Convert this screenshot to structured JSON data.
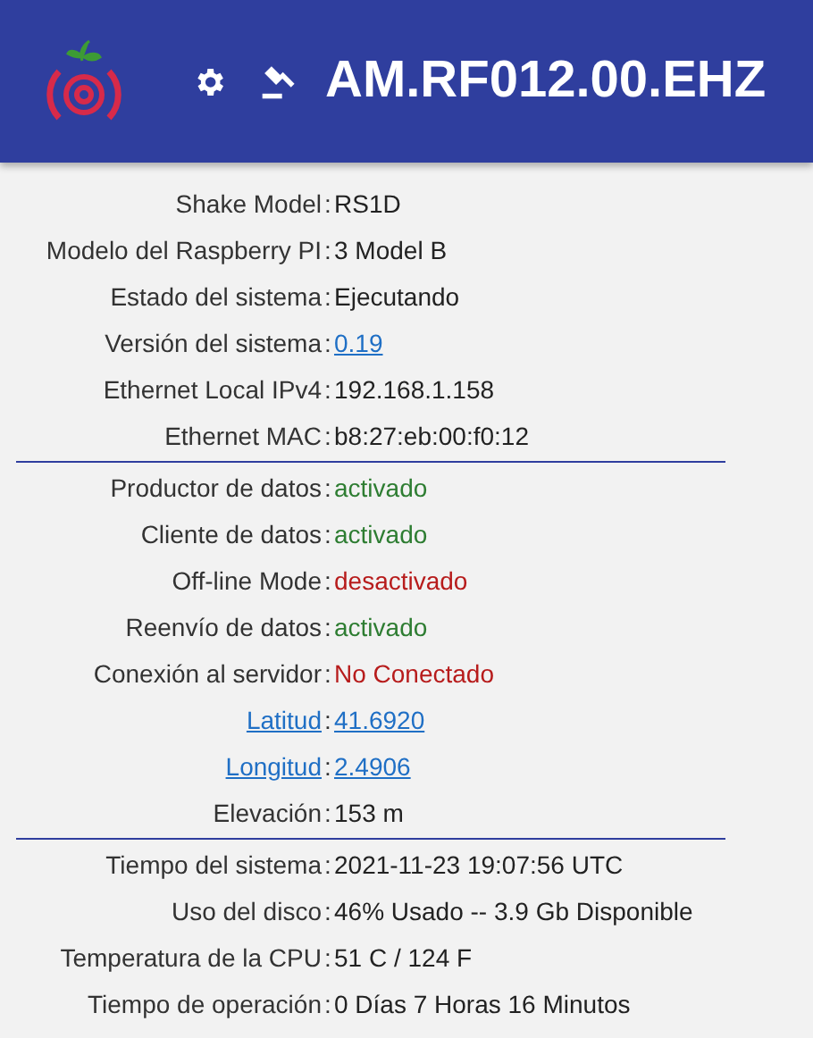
{
  "header": {
    "title": "AM.RF012.00.EHZ"
  },
  "separator": ":",
  "sections": [
    {
      "rows": [
        {
          "label": "Shake Model",
          "label_link": false,
          "value": "RS1D",
          "kind": "plain"
        },
        {
          "label": "Modelo del Raspberry PI",
          "label_link": false,
          "value": "3 Model B",
          "kind": "plain"
        },
        {
          "label": "Estado del sistema",
          "label_link": false,
          "value": "Ejecutando",
          "kind": "plain"
        },
        {
          "label": "Versión del sistema",
          "label_link": false,
          "value": "0.19",
          "kind": "link"
        },
        {
          "label": "Ethernet Local IPv4",
          "label_link": false,
          "value": "192.168.1.158",
          "kind": "plain"
        },
        {
          "label": "Ethernet MAC",
          "label_link": false,
          "value": "b8:27:eb:00:f0:12",
          "kind": "plain"
        }
      ]
    },
    {
      "rows": [
        {
          "label": "Productor de datos",
          "label_link": false,
          "value": "activado",
          "kind": "on"
        },
        {
          "label": "Cliente de datos",
          "label_link": false,
          "value": "activado",
          "kind": "on"
        },
        {
          "label": "Off-line Mode",
          "label_link": false,
          "value": "desactivado",
          "kind": "off"
        },
        {
          "label": "Reenvío de datos",
          "label_link": false,
          "value": "activado",
          "kind": "on"
        },
        {
          "label": "Conexión al servidor",
          "label_link": false,
          "value": "No Conectado",
          "kind": "off"
        },
        {
          "label": "Latitud",
          "label_link": true,
          "value": "41.6920",
          "kind": "link"
        },
        {
          "label": "Longitud",
          "label_link": true,
          "value": "2.4906",
          "kind": "link"
        },
        {
          "label": "Elevación",
          "label_link": false,
          "value": "153 m",
          "kind": "plain"
        }
      ]
    },
    {
      "rows": [
        {
          "label": "Tiempo del sistema",
          "label_link": false,
          "value": "2021-11-23 19:07:56 UTC",
          "kind": "plain"
        },
        {
          "label": "Uso del disco",
          "label_link": false,
          "value": "46% Usado -- 3.9 Gb Disponible",
          "kind": "plain"
        },
        {
          "label": "Temperatura de la CPU",
          "label_link": false,
          "value": "51 C / 124 F",
          "kind": "plain"
        },
        {
          "label": "Tiempo de operación",
          "label_link": false,
          "value": "0 Días 7 Horas 16 Minutos",
          "kind": "plain"
        }
      ]
    }
  ]
}
